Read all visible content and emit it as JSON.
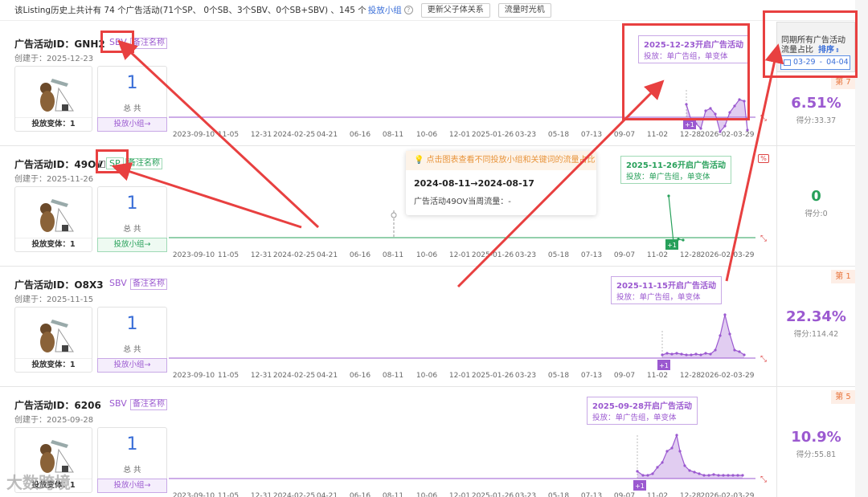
{
  "topbar": {
    "summary": "该Listing历史上共计有 74 个广告活动(71个SP、 0个SB、3个SBV、0个SB+SBV) 、145 个",
    "link": "投放小组",
    "btn1": "更新父子体关系",
    "btn2": "流量时光机"
  },
  "side": {
    "header_l1": "同期所有广告活动",
    "header_l2": "流量占比",
    "sort": "排序",
    "date_from": "03-29",
    "date_sep": "-",
    "date_to": "04-04"
  },
  "common": {
    "variant_label": "投放变体：1",
    "count": "1",
    "count_sub": "总 共",
    "group_btn": "投放小组→",
    "note": "备注名称",
    "plus": "+1",
    "callout_sub": "投放：单广告组，单变体",
    "pct_icon": "%"
  },
  "axis_ticks": [
    "2023-09-10",
    "11-05",
    "12-31",
    "2024-02-25",
    "04-21",
    "06-16",
    "08-11",
    "10-06",
    "12-01",
    "2025-01-26",
    "03-23",
    "05-18",
    "07-13",
    "09-07",
    "11-02",
    "12-28",
    "2026-02-03-29"
  ],
  "tooltip": {
    "head": "点击图表查看不同投放小组和关键词的流量占比",
    "range": "2024-08-11→2024-08-17",
    "line": "广告活动49OV当周流量：-"
  },
  "rows": [
    {
      "title": "广告活动ID：GNH2",
      "type": "SBV",
      "created": "创建于：2025-12-23",
      "callout": "2025-12-23开启广告活动",
      "rank": "第 7",
      "pct": "6.51%",
      "score": "得分:33.37"
    },
    {
      "title": "广告活动ID：49OV",
      "type": "SP",
      "created": "创建于：2025-11-26",
      "callout": "2025-11-26开启广告活动",
      "rank": "",
      "pct": "0",
      "score": "得分:0"
    },
    {
      "title": "广告活动ID：O8X3",
      "type": "SBV",
      "created": "创建于：2025-11-15",
      "callout": "2025-11-15开启广告活动",
      "rank": "第 1",
      "pct": "22.34%",
      "score": "得分:114.42"
    },
    {
      "title": "广告活动ID：6206",
      "type": "SBV",
      "created": "创建于：2025-09-28",
      "callout": "2025-09-28开启广告活动",
      "rank": "第 5",
      "pct": "10.9%",
      "score": "得分:55.81"
    }
  ],
  "watermark": "大数跨境",
  "colors": {
    "purple": "#9b59d0",
    "green": "#27a05a",
    "red_annotation": "#e84040",
    "blue": "#3b6fd8"
  }
}
